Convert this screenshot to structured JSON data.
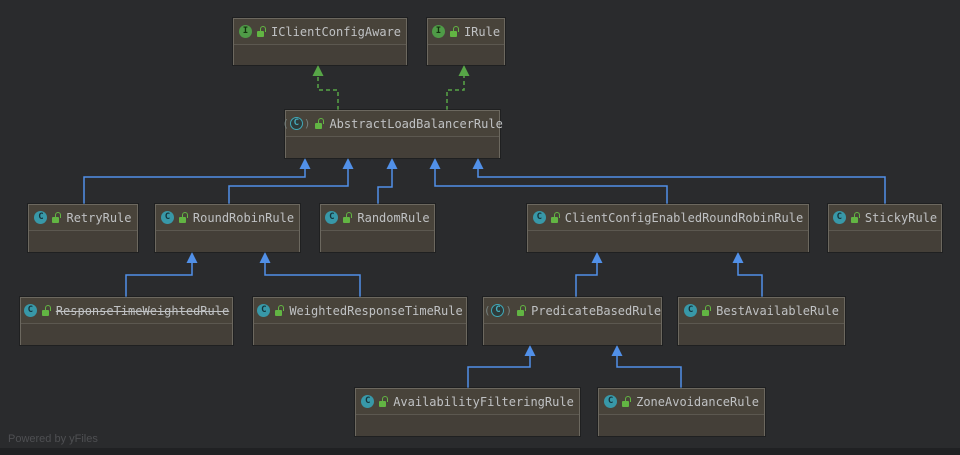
{
  "diagram": {
    "nodes": [
      {
        "id": "iclientconfigaware",
        "label": "IClientConfigAware",
        "kind": "interface",
        "deprecated": false
      },
      {
        "id": "irule",
        "label": "IRule",
        "kind": "interface",
        "deprecated": false
      },
      {
        "id": "abstractloadbalancerrule",
        "label": "AbstractLoadBalancerRule",
        "kind": "abstract",
        "deprecated": false
      },
      {
        "id": "retryrule",
        "label": "RetryRule",
        "kind": "class",
        "deprecated": false
      },
      {
        "id": "roundrobinrule",
        "label": "RoundRobinRule",
        "kind": "class",
        "deprecated": false
      },
      {
        "id": "randomrule",
        "label": "RandomRule",
        "kind": "class",
        "deprecated": false
      },
      {
        "id": "clientconfigenabledroundrobinrule",
        "label": "ClientConfigEnabledRoundRobinRule",
        "kind": "class",
        "deprecated": false
      },
      {
        "id": "stickyrule",
        "label": "StickyRule",
        "kind": "class",
        "deprecated": false
      },
      {
        "id": "responsetimeweightedrule",
        "label": "ResponseTimeWeightedRule",
        "kind": "class",
        "deprecated": true
      },
      {
        "id": "weightedresponsetimerule",
        "label": "WeightedResponseTimeRule",
        "kind": "class",
        "deprecated": false
      },
      {
        "id": "predicatebasedrule",
        "label": "PredicateBasedRule",
        "kind": "abstract",
        "deprecated": false
      },
      {
        "id": "bestavailablerule",
        "label": "BestAvailableRule",
        "kind": "class",
        "deprecated": false
      },
      {
        "id": "availabilityfilteringrule",
        "label": "AvailabilityFilteringRule",
        "kind": "class",
        "deprecated": false
      },
      {
        "id": "zoneavoidancerule",
        "label": "ZoneAvoidanceRule",
        "kind": "class",
        "deprecated": false
      }
    ],
    "icons": {
      "class_glyph": "C",
      "interface_glyph": "I",
      "abstract_glyph": "C",
      "abstract_paren_open": "(",
      "abstract_paren_close": ")"
    },
    "edges": [
      {
        "from": "abstractloadbalancerrule",
        "to": "iclientconfigaware",
        "type": "implements"
      },
      {
        "from": "abstractloadbalancerrule",
        "to": "irule",
        "type": "implements"
      },
      {
        "from": "retryrule",
        "to": "abstractloadbalancerrule",
        "type": "extends"
      },
      {
        "from": "roundrobinrule",
        "to": "abstractloadbalancerrule",
        "type": "extends"
      },
      {
        "from": "randomrule",
        "to": "abstractloadbalancerrule",
        "type": "extends"
      },
      {
        "from": "clientconfigenabledroundrobinrule",
        "to": "abstractloadbalancerrule",
        "type": "extends"
      },
      {
        "from": "stickyrule",
        "to": "abstractloadbalancerrule",
        "type": "extends"
      },
      {
        "from": "responsetimeweightedrule",
        "to": "roundrobinrule",
        "type": "extends"
      },
      {
        "from": "weightedresponsetimerule",
        "to": "roundrobinrule",
        "type": "extends"
      },
      {
        "from": "predicatebasedrule",
        "to": "clientconfigenabledroundrobinrule",
        "type": "extends"
      },
      {
        "from": "bestavailablerule",
        "to": "clientconfigenabledroundrobinrule",
        "type": "extends"
      },
      {
        "from": "availabilityfilteringrule",
        "to": "predicatebasedrule",
        "type": "extends"
      },
      {
        "from": "zoneavoidancerule",
        "to": "predicatebasedrule",
        "type": "extends"
      }
    ],
    "colors": {
      "extends_edge": "#5190e8",
      "implements_edge": "#57a647",
      "node_fill": "#48433a",
      "node_border": "#6c685f",
      "label_text": "#bfc1c3",
      "class_icon": "#3898a8",
      "interface_icon": "#4f9b47",
      "padlock_icon": "#62b543",
      "background": "#2a2b2d"
    },
    "footer": {
      "text": "Powered by yFiles"
    }
  }
}
